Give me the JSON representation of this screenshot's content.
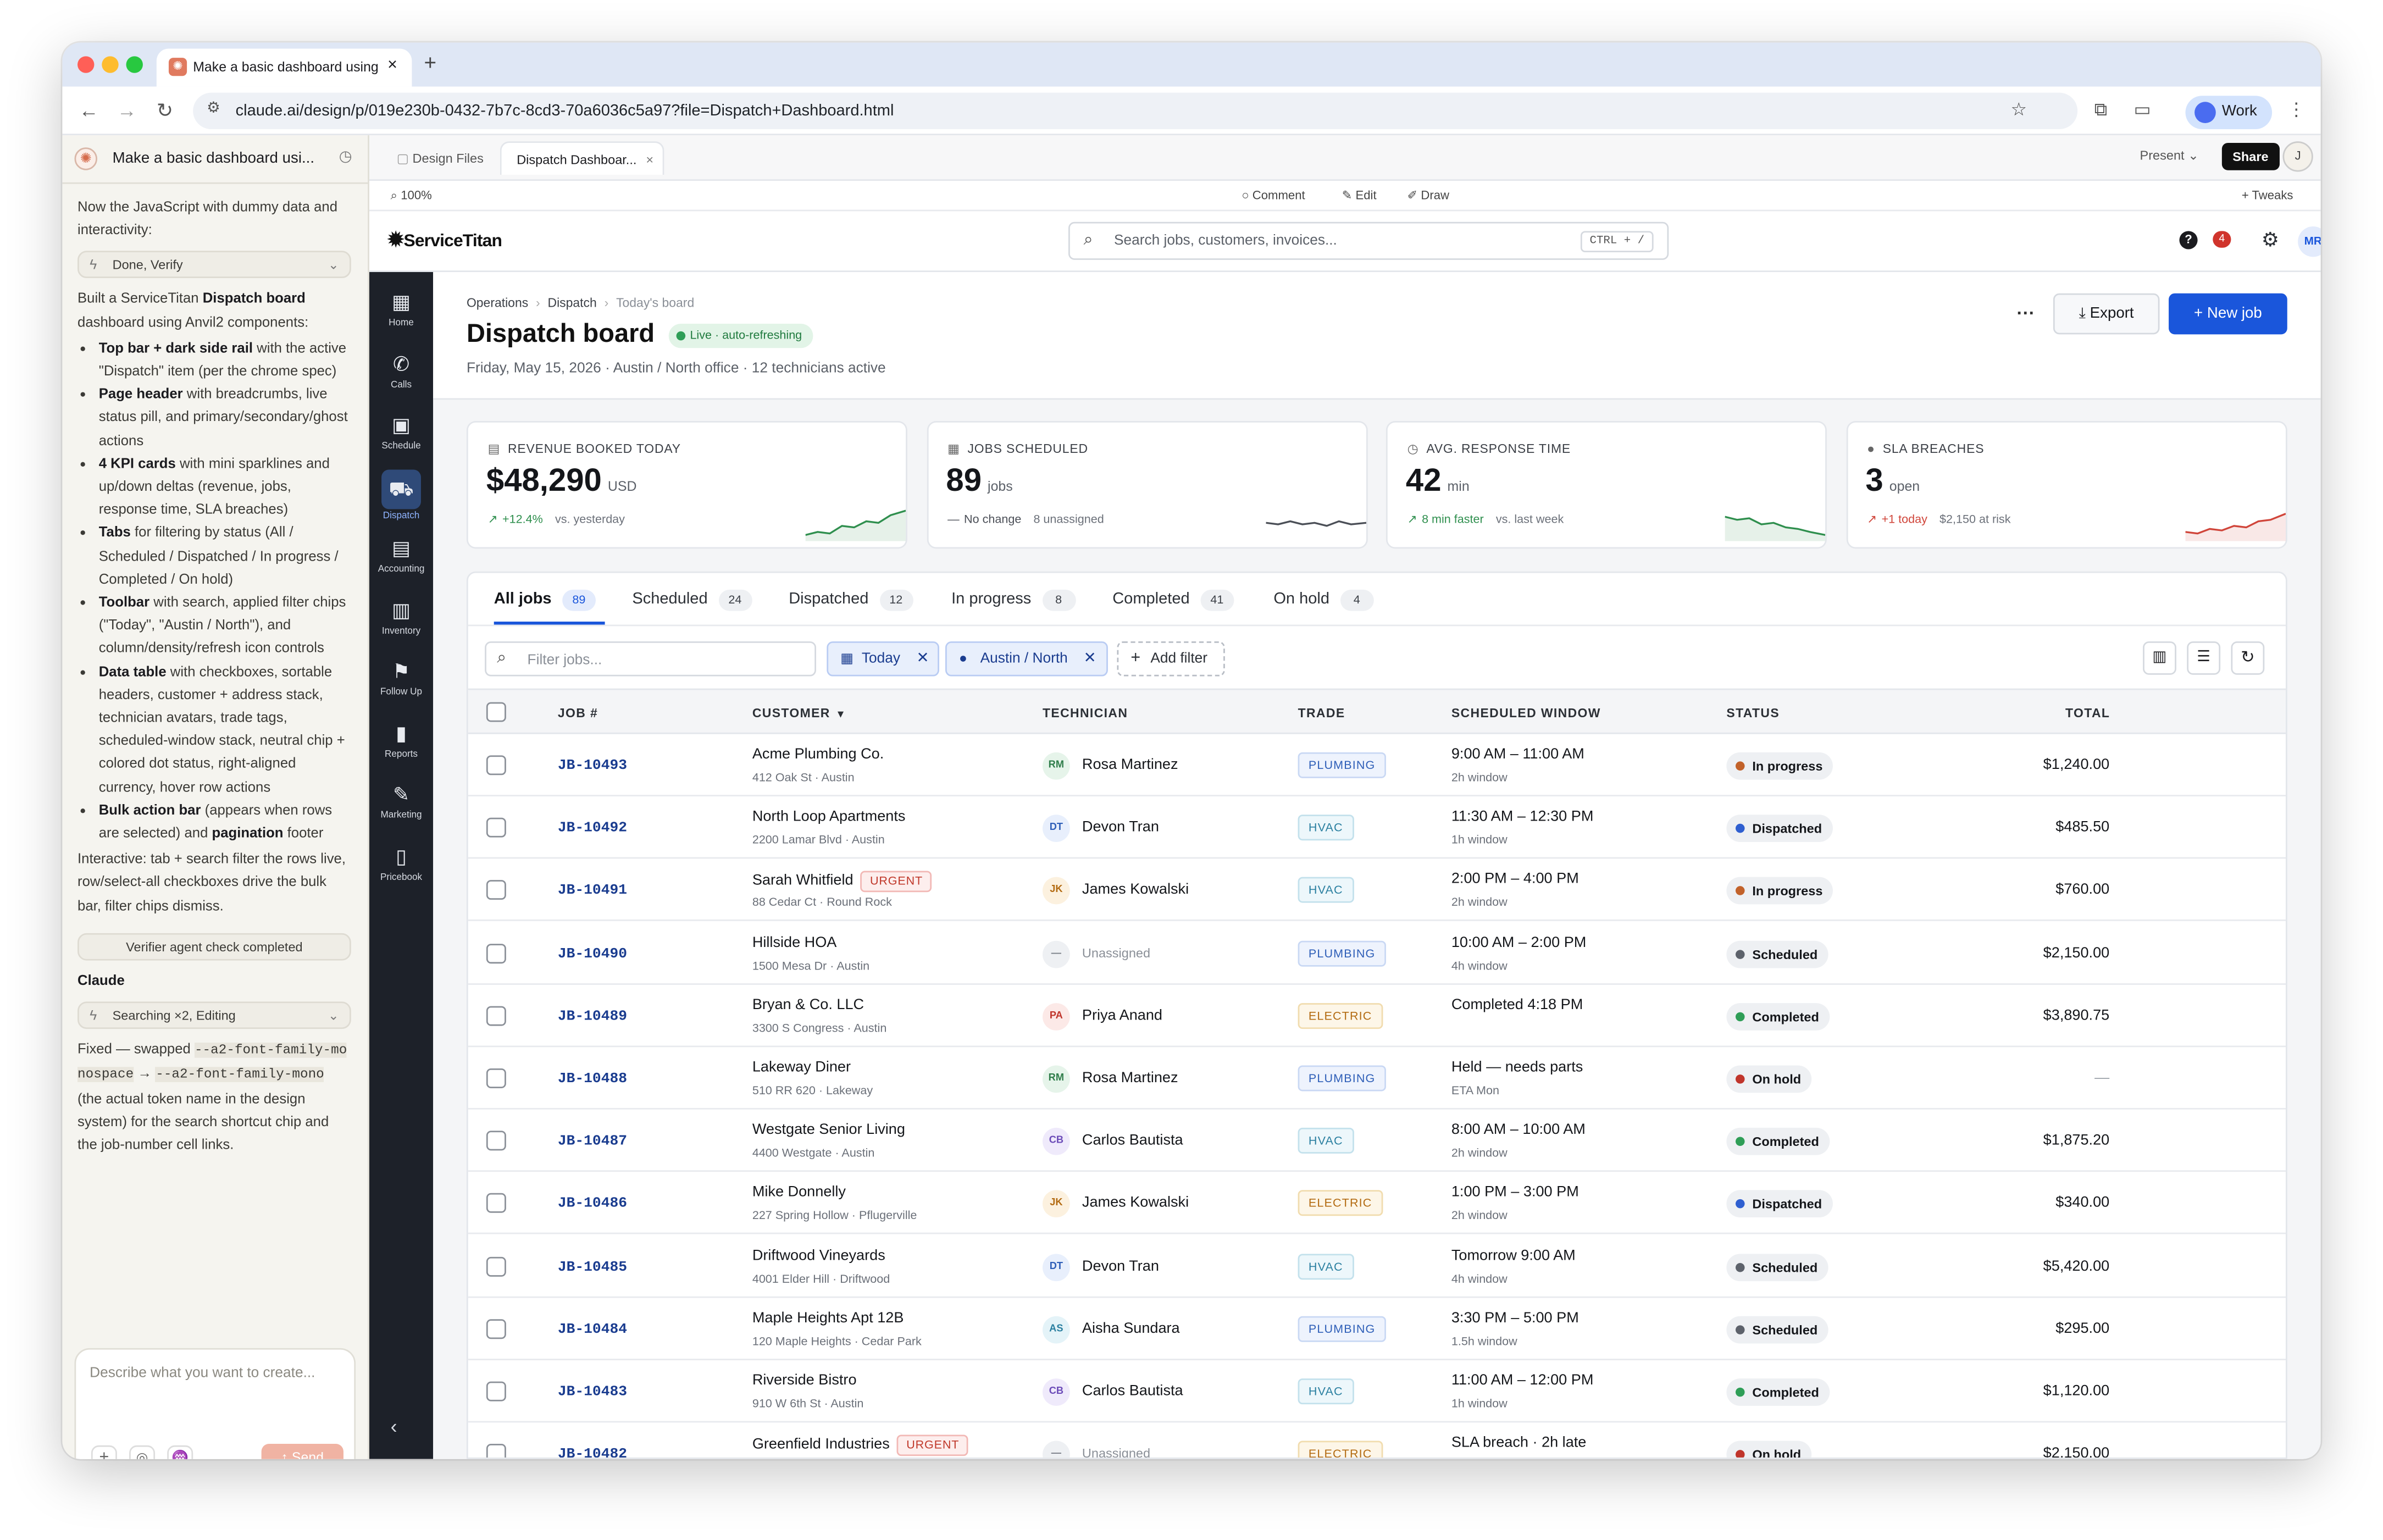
{
  "browser": {
    "tab_title": "Make a basic dashboard using",
    "url": "claude.ai/design/p/019e230b-0432-7b7c-8cd3-70a6036c5a97?file=Dispatch+Dashboard.html",
    "profile_label": "Work"
  },
  "claude_panel": {
    "title": "Make a basic dashboard usi...",
    "intro": "Now the JavaScript with dummy data and interactivity:",
    "step1": "Done, Verify",
    "summary_pre": "Built a ServiceTitan ",
    "summary_bold": "Dispatch board",
    "summary_post": " dashboard using Anvil2 components:",
    "bullets": [
      {
        "bold": "Top bar + dark side rail",
        "text": " with the active \"Dispatch\" item (per the chrome spec)"
      },
      {
        "bold": "Page header",
        "text": " with breadcrumbs, live status pill, and primary/secondary/ghost actions"
      },
      {
        "bold": "4 KPI cards",
        "text": " with mini sparklines and up/down deltas (revenue, jobs, response time, SLA breaches)"
      },
      {
        "bold": "Tabs",
        "text": " for filtering by status (All / Scheduled / Dispatched / In progress / Completed / On hold)"
      },
      {
        "bold": "Toolbar",
        "text": " with search, applied filter chips (\"Today\", \"Austin / North\"), and column/density/refresh icon controls"
      },
      {
        "bold": "Data table",
        "text": " with checkboxes, sortable headers, customer + address stack, technician avatars, trade tags, scheduled-window stack, neutral chip + colored dot status, right-aligned currency, hover row actions"
      },
      {
        "bold": "Bulk action bar",
        "text": " (appears when rows are selected) and ",
        "bold2": "pagination",
        "text2": " footer"
      }
    ],
    "interactive": "Interactive: tab + search filter the rows live, row/select-all checkboxes drive the bulk bar, filter chips dismiss.",
    "verifier": "Verifier agent check completed",
    "claude_label": "Claude",
    "step2": "Searching ×2, Editing",
    "fixed_1": "Fixed — swapped ",
    "code_1": "--a2-font-family-monospace",
    "arrow": " → ",
    "code_2": "--a2-font-family-mono",
    "fixed_2": " (the actual token name in the design system) for the search shortcut chip and the job-number cell links.",
    "composer_placeholder": "Describe what you want to create...",
    "send_label": "Send"
  },
  "design_tabs": {
    "files": "Design Files",
    "active": "Dispatch Dashboar...",
    "present": "Present",
    "share": "Share",
    "user_initial": "J"
  },
  "design_tools": {
    "zoom": "100%",
    "comment": "Comment",
    "edit": "Edit",
    "draw": "Draw",
    "tweaks": "Tweaks"
  },
  "app": {
    "brand": "ServiceTitan",
    "search_placeholder": "Search jobs, customers, invoices...",
    "shortcut": "CTRL + /",
    "notif_count": "4",
    "user_initials": "MR",
    "rail": [
      {
        "label": "Home",
        "icon": "home-icon",
        "glyph": "▦"
      },
      {
        "label": "Calls",
        "icon": "phone-icon",
        "glyph": "✆"
      },
      {
        "label": "Schedule",
        "icon": "calendar-icon",
        "glyph": "▣"
      },
      {
        "label": "Dispatch",
        "icon": "truck-icon",
        "glyph": "⛟"
      },
      {
        "label": "Accounting",
        "icon": "clipboard-icon",
        "glyph": "▤"
      },
      {
        "label": "Inventory",
        "icon": "box-icon",
        "glyph": "▥"
      },
      {
        "label": "Follow Up",
        "icon": "flag-icon",
        "glyph": "⚑"
      },
      {
        "label": "Reports",
        "icon": "bar-chart-icon",
        "glyph": "▮"
      },
      {
        "label": "Marketing",
        "icon": "edit-icon",
        "glyph": "✎"
      },
      {
        "label": "Pricebook",
        "icon": "book-icon",
        "glyph": "▯"
      }
    ],
    "breadcrumbs": [
      "Operations",
      "Dispatch",
      "Today's board"
    ],
    "title": "Dispatch board",
    "live_pill": "Live · auto-refreshing",
    "subtitle": "Friday, May 15, 2026 · Austin / North office · 12 technicians active",
    "export_label": "Export",
    "new_job_label": "New job",
    "kpis": [
      {
        "label": "REVENUE BOOKED TODAY",
        "value": "$48,290",
        "unit": "USD",
        "delta": "+12.4%",
        "note": "vs. yesterday",
        "trend": "up",
        "color": "#2f8f4e"
      },
      {
        "label": "JOBS SCHEDULED",
        "value": "89",
        "unit": "jobs",
        "delta": "No change",
        "note": "8 unassigned",
        "trend": "flat",
        "color": "#4b4f57"
      },
      {
        "label": "AVG. RESPONSE TIME",
        "value": "42",
        "unit": "min",
        "delta": "8 min faster",
        "note": "vs. last week",
        "trend": "down",
        "color": "#2f8f4e"
      },
      {
        "label": "SLA BREACHES",
        "value": "3",
        "unit": "open",
        "delta": "+1 today",
        "note": "$2,150 at risk",
        "trend": "up",
        "color": "#d0453a"
      }
    ],
    "tabs": [
      {
        "label": "All jobs",
        "count": "89"
      },
      {
        "label": "Scheduled",
        "count": "24"
      },
      {
        "label": "Dispatched",
        "count": "12"
      },
      {
        "label": "In progress",
        "count": "8"
      },
      {
        "label": "Completed",
        "count": "41"
      },
      {
        "label": "On hold",
        "count": "4"
      }
    ],
    "filter_placeholder": "Filter jobs...",
    "chips": [
      "Today",
      "Austin / North"
    ],
    "add_filter": "Add filter",
    "columns": [
      "JOB #",
      "CUSTOMER",
      "TECHNICIAN",
      "TRADE",
      "SCHEDULED WINDOW",
      "STATUS",
      "TOTAL"
    ],
    "rows": [
      {
        "job": "JB-10493",
        "customer": "Acme Plumbing Co.",
        "address": "412 Oak St · Austin",
        "urgent": "",
        "initials": "RM",
        "tech": "Rosa Martinez",
        "trade": "PLUMBING",
        "window": "9:00 AM – 11:00 AM",
        "window_sub": "2h window",
        "status": "In progress",
        "total": "$1,240.00"
      },
      {
        "job": "JB-10492",
        "customer": "North Loop Apartments",
        "address": "2200 Lamar Blvd · Austin",
        "urgent": "",
        "initials": "DT",
        "tech": "Devon Tran",
        "trade": "HVAC",
        "window": "11:30 AM – 12:30 PM",
        "window_sub": "1h window",
        "status": "Dispatched",
        "total": "$485.50"
      },
      {
        "job": "JB-10491",
        "customer": "Sarah Whitfield",
        "address": "88 Cedar Ct · Round Rock",
        "urgent": "URGENT",
        "initials": "JK",
        "tech": "James Kowalski",
        "trade": "HVAC",
        "window": "2:00 PM – 4:00 PM",
        "window_sub": "2h window",
        "status": "In progress",
        "total": "$760.00"
      },
      {
        "job": "JB-10490",
        "customer": "Hillside HOA",
        "address": "1500 Mesa Dr · Austin",
        "urgent": "",
        "initials": "—",
        "tech": "Unassigned",
        "trade": "PLUMBING",
        "window": "10:00 AM – 2:00 PM",
        "window_sub": "4h window",
        "status": "Scheduled",
        "total": "$2,150.00"
      },
      {
        "job": "JB-10489",
        "customer": "Bryan & Co. LLC",
        "address": "3300 S Congress · Austin",
        "urgent": "",
        "initials": "PA",
        "tech": "Priya Anand",
        "trade": "ELECTRIC",
        "window": "Completed 4:18 PM",
        "window_sub": "",
        "status": "Completed",
        "total": "$3,890.75"
      },
      {
        "job": "JB-10488",
        "customer": "Lakeway Diner",
        "address": "510 RR 620 · Lakeway",
        "urgent": "",
        "initials": "RM",
        "tech": "Rosa Martinez",
        "trade": "PLUMBING",
        "window": "Held — needs parts",
        "window_sub": "ETA Mon",
        "status": "On hold",
        "total": "—"
      },
      {
        "job": "JB-10487",
        "customer": "Westgate Senior Living",
        "address": "4400 Westgate · Austin",
        "urgent": "",
        "initials": "CB",
        "tech": "Carlos Bautista",
        "trade": "HVAC",
        "window": "8:00 AM – 10:00 AM",
        "window_sub": "2h window",
        "status": "Completed",
        "total": "$1,875.20"
      },
      {
        "job": "JB-10486",
        "customer": "Mike Donnelly",
        "address": "227 Spring Hollow · Pflugerville",
        "urgent": "",
        "initials": "JK",
        "tech": "James Kowalski",
        "trade": "ELECTRIC",
        "window": "1:00 PM – 3:00 PM",
        "window_sub": "2h window",
        "status": "Dispatched",
        "total": "$340.00"
      },
      {
        "job": "JB-10485",
        "customer": "Driftwood Vineyards",
        "address": "4001 Elder Hill · Driftwood",
        "urgent": "",
        "initials": "DT",
        "tech": "Devon Tran",
        "trade": "HVAC",
        "window": "Tomorrow 9:00 AM",
        "window_sub": "4h window",
        "status": "Scheduled",
        "total": "$5,420.00"
      },
      {
        "job": "JB-10484",
        "customer": "Maple Heights Apt 12B",
        "address": "120 Maple Heights · Cedar Park",
        "urgent": "",
        "initials": "AS",
        "tech": "Aisha Sundara",
        "trade": "PLUMBING",
        "window": "3:30 PM – 5:00 PM",
        "window_sub": "1.5h window",
        "status": "Scheduled",
        "total": "$295.00"
      },
      {
        "job": "JB-10483",
        "customer": "Riverside Bistro",
        "address": "910 W 6th St · Austin",
        "urgent": "",
        "initials": "CB",
        "tech": "Carlos Bautista",
        "trade": "HVAC",
        "window": "11:00 AM – 12:00 PM",
        "window_sub": "1h window",
        "status": "Completed",
        "total": "$1,120.00"
      },
      {
        "job": "JB-10482",
        "customer": "Greenfield Industries",
        "address": "",
        "urgent": "URGENT",
        "initials": "—",
        "tech": "Unassigned",
        "trade": "ELECTRIC",
        "window": "SLA breach · 2h late",
        "window_sub": "",
        "status": "On hold",
        "total": "$2,150.00"
      }
    ],
    "colors": {
      "primary": "#1a56db",
      "rail_bg": "#1d2129",
      "status_dots": {
        "In progress": "#c2622a",
        "Dispatched": "#2f5fd0",
        "Scheduled": "#5d626b",
        "Completed": "#2f9e57",
        "On hold": "#c0352b"
      },
      "trades": {
        "PLUMBING": {
          "fg": "#2f5fb8",
          "bg": "#eef3fd",
          "bd": "#c9d8f4"
        },
        "HVAC": {
          "fg": "#2a7fa0",
          "bg": "#edf7fb",
          "bd": "#c3e1ec"
        },
        "ELECTRIC": {
          "fg": "#b36b12",
          "bg": "#fdf6e8",
          "bd": "#f1dcae"
        }
      },
      "avatars": {
        "RM": {
          "fg": "#2f7d4a",
          "bg": "#e6f4ea"
        },
        "DT": {
          "fg": "#2f5fb8",
          "bg": "#e8effc"
        },
        "JK": {
          "fg": "#b36b12",
          "bg": "#fcf1df"
        },
        "PA": {
          "fg": "#c0352b",
          "bg": "#fce9e7"
        },
        "CB": {
          "fg": "#6b4bb8",
          "bg": "#efeafb"
        },
        "AS": {
          "fg": "#2a7fa0",
          "bg": "#e4f3f8"
        },
        "—": {
          "fg": "#7a7f88",
          "bg": "#eef0f3"
        }
      }
    }
  }
}
